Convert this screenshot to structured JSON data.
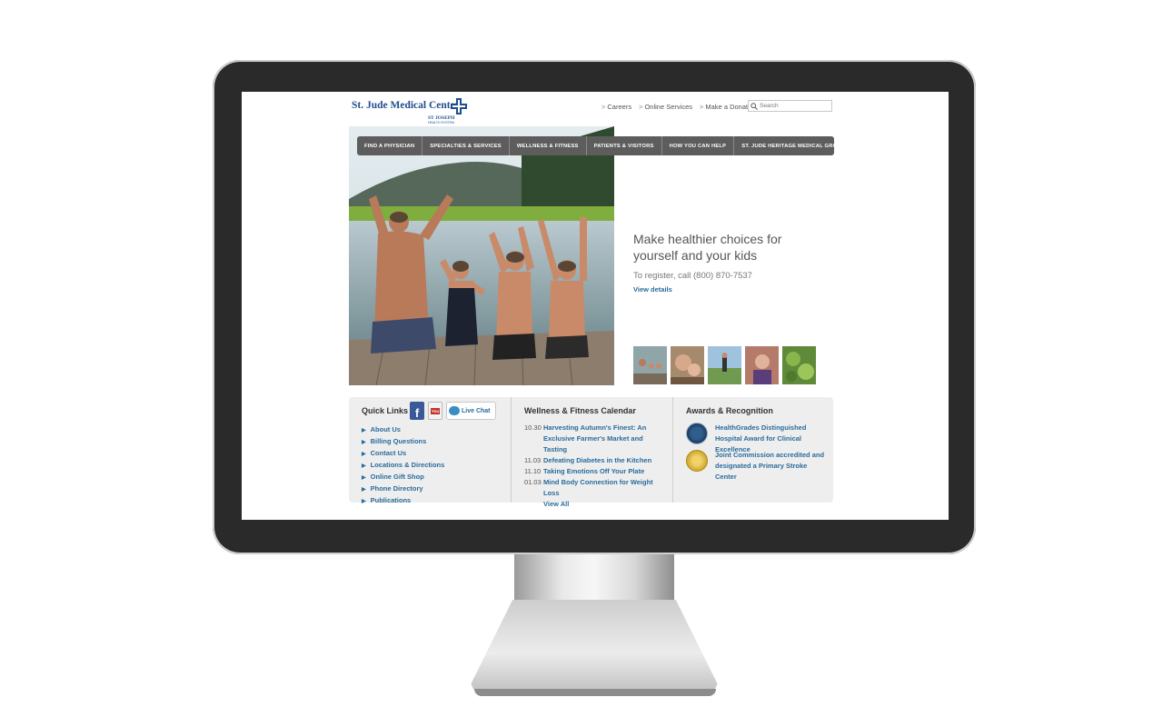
{
  "site": {
    "logo": {
      "name": "St. Jude Medical Center",
      "sub1": "ST JOSEPH",
      "sub2": "HEALTH SYSTEM"
    },
    "top_links": [
      "Careers",
      "Online Services",
      "Make a Donation"
    ],
    "search_placeholder": "Search",
    "nav": [
      "FIND A PHYSICIAN",
      "SPECIALTIES & SERVICES",
      "WELLNESS & FITNESS",
      "PATIENTS & VISITORS",
      "HOW YOU CAN HELP",
      "ST. JUDE HERITAGE MEDICAL GROUP"
    ],
    "hero": {
      "title": "Make healthier choices for yourself and your kids",
      "sub": "To register, call (800) 870-7537",
      "link": "View details"
    },
    "quick_links": {
      "title": "Quick Links",
      "live_chat": "Live Chat",
      "items": [
        "About Us",
        "Billing Questions",
        "Contact Us",
        "Locations & Directions",
        "Online Gift Shop",
        "Phone Directory",
        "Publications"
      ]
    },
    "calendar": {
      "title": "Wellness & Fitness Calendar",
      "events": [
        {
          "date": "10.30",
          "title": "Harvesting Autumn's Finest: An Exclusive Farmer's Market and Tasting"
        },
        {
          "date": "11.03",
          "title": "Defeating Diabetes in the Kitchen"
        },
        {
          "date": "11.10",
          "title": "Taking Emotions Off Your Plate"
        },
        {
          "date": "01.03",
          "title": "Mind Body Connection for Weight Loss"
        }
      ],
      "view_all": "View All"
    },
    "awards": {
      "title": "Awards & Recognition",
      "items": [
        "HealthGrades Distinguished Hospital Award for Clinical Excellence",
        "Joint Commission accredited and designated a Primary Stroke Center"
      ]
    }
  }
}
